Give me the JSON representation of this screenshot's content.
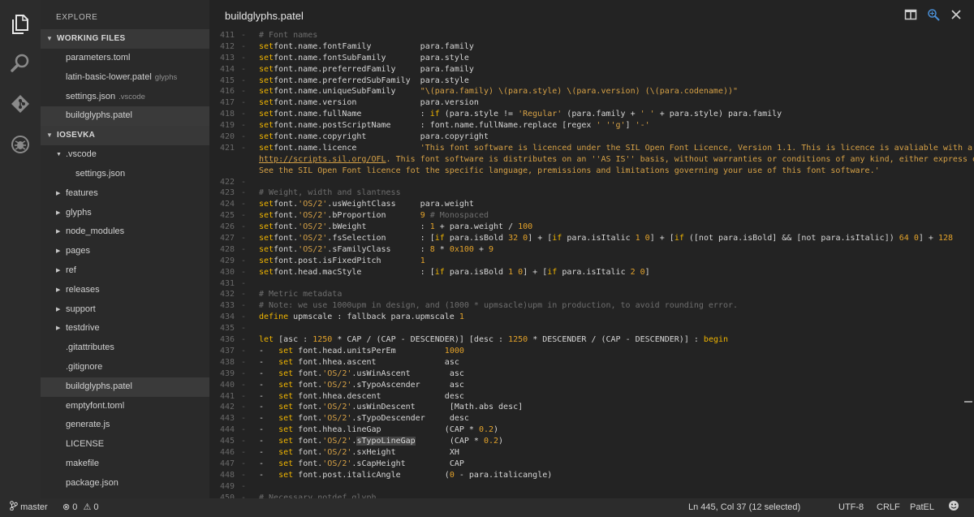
{
  "activity_bar": {
    "items": [
      {
        "icon": "files-icon",
        "active": true
      },
      {
        "icon": "search-icon",
        "active": false
      },
      {
        "icon": "git-icon",
        "active": false
      },
      {
        "icon": "debug-icon",
        "active": false
      }
    ]
  },
  "sidebar": {
    "title": "EXPLORE",
    "working_files_header": "WORKING FILES",
    "working_files": [
      {
        "name": "parameters.toml",
        "hint": ""
      },
      {
        "name": "latin-basic-lower.patel",
        "hint": "glyphs"
      },
      {
        "name": "settings.json",
        "hint": ".vscode"
      },
      {
        "name": "buildglyphs.patel",
        "hint": "",
        "active": true
      }
    ],
    "project_header": "IOSEVKA",
    "tree": [
      {
        "name": ".vscode",
        "type": "folder-open",
        "indent": 0
      },
      {
        "name": "settings.json",
        "type": "file",
        "indent": 1
      },
      {
        "name": "features",
        "type": "folder",
        "indent": 0
      },
      {
        "name": "glyphs",
        "type": "folder",
        "indent": 0
      },
      {
        "name": "node_modules",
        "type": "folder",
        "indent": 0
      },
      {
        "name": "pages",
        "type": "folder",
        "indent": 0
      },
      {
        "name": "ref",
        "type": "folder",
        "indent": 0
      },
      {
        "name": "releases",
        "type": "folder",
        "indent": 0
      },
      {
        "name": "support",
        "type": "folder",
        "indent": 0
      },
      {
        "name": "testdrive",
        "type": "folder",
        "indent": 0
      },
      {
        "name": ".gitattributes",
        "type": "file",
        "indent": 0
      },
      {
        "name": ".gitignore",
        "type": "file",
        "indent": 0
      },
      {
        "name": "buildglyphs.patel",
        "type": "file",
        "indent": 0,
        "active": true
      },
      {
        "name": "emptyfont.toml",
        "type": "file",
        "indent": 0
      },
      {
        "name": "generate.js",
        "type": "file",
        "indent": 0
      },
      {
        "name": "LICENSE",
        "type": "file",
        "indent": 0
      },
      {
        "name": "makefile",
        "type": "file",
        "indent": 0
      },
      {
        "name": "package.json",
        "type": "file",
        "indent": 0
      }
    ]
  },
  "editor": {
    "title": "buildglyphs.patel",
    "split_icon": "split-editor-icon",
    "diff_icon": "open-changes-icon",
    "lines": [
      {
        "n": "411",
        "fold": "-",
        "segs": [
          [
            "c",
            "# Font names"
          ]
        ]
      },
      {
        "n": "412",
        "fold": "-",
        "segs": [
          [
            "k",
            "set"
          ],
          [
            "",
            "font.name.fontFamily          para.family"
          ]
        ]
      },
      {
        "n": "413",
        "fold": "-",
        "segs": [
          [
            "k",
            "set"
          ],
          [
            "",
            "font.name.fontSubFamily       para.style"
          ]
        ]
      },
      {
        "n": "414",
        "fold": "-",
        "segs": [
          [
            "k",
            "set"
          ],
          [
            "",
            "font.name.preferredFamily     para.family"
          ]
        ]
      },
      {
        "n": "415",
        "fold": "-",
        "segs": [
          [
            "k",
            "set"
          ],
          [
            "",
            "font.name.preferredSubFamily  para.style"
          ]
        ]
      },
      {
        "n": "416",
        "fold": "-",
        "segs": [
          [
            "k",
            "set"
          ],
          [
            "",
            "font.name.uniqueSubFamily     "
          ],
          [
            "s",
            "\"\\(para.family) \\(para.style) \\(para.version) (\\(para.codename))\""
          ]
        ]
      },
      {
        "n": "417",
        "fold": "-",
        "segs": [
          [
            "k",
            "set"
          ],
          [
            "",
            "font.name.version             para.version"
          ]
        ]
      },
      {
        "n": "418",
        "fold": "-",
        "segs": [
          [
            "k",
            "set"
          ],
          [
            "",
            "font.name.fullName            : "
          ],
          [
            "k",
            "if"
          ],
          [
            "",
            " (para.style != "
          ],
          [
            "s",
            "'Regular'"
          ],
          [
            "",
            " (para.family + "
          ],
          [
            "s",
            "' '"
          ],
          [
            "",
            " + para.style) para.family"
          ]
        ]
      },
      {
        "n": "419",
        "fold": "-",
        "segs": [
          [
            "k",
            "set"
          ],
          [
            "",
            "font.name.postScriptName      : font.name.fullName.replace [regex "
          ],
          [
            "s",
            "' '"
          ],
          [
            " ",
            ""
          ],
          [
            "s",
            "'g'"
          ],
          [
            "",
            "] "
          ],
          [
            "s",
            "'-'"
          ]
        ]
      },
      {
        "n": "420",
        "fold": "-",
        "segs": [
          [
            "k",
            "set"
          ],
          [
            "",
            "font.name.copyright           para.copyright"
          ]
        ]
      },
      {
        "n": "421",
        "fold": "-",
        "segs": [
          [
            "k",
            "set"
          ],
          [
            "",
            "font.name.licence             "
          ],
          [
            "s",
            "'This font software is licenced under the SIL Open Font Licence, Version 1.1. This is licence is avaliable with a FAQ at:¬"
          ]
        ]
      },
      {
        "n": "",
        "fold": "",
        "segs": [
          [
            "u",
            "http://scripts.sil.org/OFL"
          ],
          [
            "s",
            ". This font software is distributes on an ''AS IS'' basis, without warranties or conditions of any kind, either express or implied.¬"
          ]
        ]
      },
      {
        "n": "",
        "fold": "",
        "segs": [
          [
            "s",
            "See the SIL Open Font licence fot the specific language, premissions and limitations governing your use of this font software.'"
          ]
        ]
      },
      {
        "n": "422",
        "fold": "-",
        "segs": []
      },
      {
        "n": "423",
        "fold": "-",
        "segs": [
          [
            "c",
            "# Weight, width and slantness"
          ]
        ]
      },
      {
        "n": "424",
        "fold": "-",
        "segs": [
          [
            "k",
            "set"
          ],
          [
            "",
            "font."
          ],
          [
            "s",
            "'OS/2'"
          ],
          [
            "",
            ".usWeightClass     para.weight"
          ]
        ]
      },
      {
        "n": "425",
        "fold": "-",
        "segs": [
          [
            "k",
            "set"
          ],
          [
            "",
            "font."
          ],
          [
            "s",
            "'OS/2'"
          ],
          [
            "",
            ".bProportion       "
          ],
          [
            "n",
            "9"
          ],
          [
            "c",
            " # Monospaced"
          ]
        ]
      },
      {
        "n": "426",
        "fold": "-",
        "segs": [
          [
            "k",
            "set"
          ],
          [
            "",
            "font."
          ],
          [
            "s",
            "'OS/2'"
          ],
          [
            "",
            ".bWeight           : "
          ],
          [
            "n",
            "1"
          ],
          [
            "",
            " + para.weight / "
          ],
          [
            "n",
            "100"
          ]
        ]
      },
      {
        "n": "427",
        "fold": "-",
        "segs": [
          [
            "k",
            "set"
          ],
          [
            "",
            "font."
          ],
          [
            "s",
            "'OS/2'"
          ],
          [
            "",
            ".fsSelection       : ["
          ],
          [
            "k",
            "if"
          ],
          [
            "",
            " para.isBold "
          ],
          [
            "n",
            "32 0"
          ],
          [
            "",
            "] + ["
          ],
          [
            "k",
            "if"
          ],
          [
            "",
            " para.isItalic "
          ],
          [
            "n",
            "1 0"
          ],
          [
            "",
            "] + ["
          ],
          [
            "k",
            "if"
          ],
          [
            "",
            " ([not para.isBold] && [not para.isItalic]) "
          ],
          [
            "n",
            "64 0"
          ],
          [
            "",
            "] + "
          ],
          [
            "n",
            "128"
          ]
        ]
      },
      {
        "n": "428",
        "fold": "-",
        "segs": [
          [
            "k",
            "set"
          ],
          [
            "",
            "font."
          ],
          [
            "s",
            "'OS/2'"
          ],
          [
            "",
            ".sFamilyClass      : "
          ],
          [
            "n",
            "8"
          ],
          [
            "",
            " * "
          ],
          [
            "n",
            "0x100"
          ],
          [
            "",
            " + "
          ],
          [
            "n",
            "9"
          ]
        ]
      },
      {
        "n": "429",
        "fold": "-",
        "segs": [
          [
            "k",
            "set"
          ],
          [
            "",
            "font.post.isFixedPitch        "
          ],
          [
            "n",
            "1"
          ]
        ]
      },
      {
        "n": "430",
        "fold": "-",
        "segs": [
          [
            "k",
            "set"
          ],
          [
            "",
            "font.head.macStyle            : ["
          ],
          [
            "k",
            "if"
          ],
          [
            "",
            " para.isBold "
          ],
          [
            "n",
            "1 0"
          ],
          [
            "",
            "] + ["
          ],
          [
            "k",
            "if"
          ],
          [
            "",
            " para.isItalic "
          ],
          [
            "n",
            "2 0"
          ],
          [
            "",
            "]"
          ]
        ]
      },
      {
        "n": "431",
        "fold": "-",
        "segs": []
      },
      {
        "n": "432",
        "fold": "-",
        "segs": [
          [
            "c",
            "# Metric metadata"
          ]
        ]
      },
      {
        "n": "433",
        "fold": "-",
        "segs": [
          [
            "c",
            "# Note: we use 1000upm in design, and (1000 * upmsacle)upm in production, to avoid rounding error."
          ]
        ]
      },
      {
        "n": "434",
        "fold": "-",
        "segs": [
          [
            "k",
            "define"
          ],
          [
            "",
            " upmscale : fallback para.upmscale "
          ],
          [
            "n",
            "1"
          ]
        ]
      },
      {
        "n": "435",
        "fold": "-",
        "segs": []
      },
      {
        "n": "436",
        "fold": "-",
        "segs": [
          [
            "k",
            "let"
          ],
          [
            "",
            " [asc : "
          ],
          [
            "n",
            "1250"
          ],
          [
            "",
            " * CAP / (CAP - DESCENDER)] [desc : "
          ],
          [
            "n",
            "1250"
          ],
          [
            "",
            " * DESCENDER / (CAP - DESCENDER)] : "
          ],
          [
            "k",
            "begin"
          ]
        ]
      },
      {
        "n": "437",
        "fold": "-",
        "segs": [
          [
            "",
            "-   "
          ],
          [
            "k",
            "set"
          ],
          [
            "",
            " font.head.unitsPerEm          "
          ],
          [
            "n",
            "1000"
          ]
        ]
      },
      {
        "n": "438",
        "fold": "-",
        "segs": [
          [
            "",
            "-   "
          ],
          [
            "k",
            "set"
          ],
          [
            "",
            " font.hhea.ascent              asc"
          ]
        ]
      },
      {
        "n": "439",
        "fold": "-",
        "segs": [
          [
            "",
            "-   "
          ],
          [
            "k",
            "set"
          ],
          [
            "",
            " font."
          ],
          [
            "s",
            "'OS/2'"
          ],
          [
            "",
            ".usWinAscent        asc"
          ]
        ]
      },
      {
        "n": "440",
        "fold": "-",
        "segs": [
          [
            "",
            "-   "
          ],
          [
            "k",
            "set"
          ],
          [
            "",
            " font."
          ],
          [
            "s",
            "'OS/2'"
          ],
          [
            "",
            ".sTypoAscender      asc"
          ]
        ]
      },
      {
        "n": "441",
        "fold": "-",
        "segs": [
          [
            "",
            "-   "
          ],
          [
            "k",
            "set"
          ],
          [
            "",
            " font.hhea.descent             desc"
          ]
        ]
      },
      {
        "n": "442",
        "fold": "-",
        "segs": [
          [
            "",
            "-   "
          ],
          [
            "k",
            "set"
          ],
          [
            "",
            " font."
          ],
          [
            "s",
            "'OS/2'"
          ],
          [
            "",
            ".usWinDescent       [Math.abs desc]"
          ]
        ]
      },
      {
        "n": "443",
        "fold": "-",
        "segs": [
          [
            "",
            "-   "
          ],
          [
            "k",
            "set"
          ],
          [
            "",
            " font."
          ],
          [
            "s",
            "'OS/2'"
          ],
          [
            "",
            ".sTypoDescender     desc"
          ]
        ]
      },
      {
        "n": "444",
        "fold": "-",
        "segs": [
          [
            "",
            "-   "
          ],
          [
            "k",
            "set"
          ],
          [
            "",
            " font.hhea.lineGap             (CAP * "
          ],
          [
            "n",
            "0.2"
          ],
          [
            "",
            ")"
          ]
        ]
      },
      {
        "n": "445",
        "fold": "-",
        "segs": [
          [
            "",
            "-   "
          ],
          [
            "k",
            "set"
          ],
          [
            "",
            " font."
          ],
          [
            "s",
            "'OS/2'"
          ],
          [
            "",
            "."
          ],
          [
            "sel",
            "sTypoLineGap"
          ],
          [
            "",
            "       (CAP * "
          ],
          [
            "n",
            "0.2"
          ],
          [
            "",
            ")"
          ]
        ]
      },
      {
        "n": "446",
        "fold": "-",
        "segs": [
          [
            "",
            "-   "
          ],
          [
            "k",
            "set"
          ],
          [
            "",
            " font."
          ],
          [
            "s",
            "'OS/2'"
          ],
          [
            "",
            ".sxHeight           XH"
          ]
        ]
      },
      {
        "n": "447",
        "fold": "-",
        "segs": [
          [
            "",
            "-   "
          ],
          [
            "k",
            "set"
          ],
          [
            "",
            " font."
          ],
          [
            "s",
            "'OS/2'"
          ],
          [
            "",
            ".sCapHeight         CAP"
          ]
        ]
      },
      {
        "n": "448",
        "fold": "-",
        "segs": [
          [
            "",
            "-   "
          ],
          [
            "k",
            "set"
          ],
          [
            "",
            " font.post.italicAngle         ("
          ],
          [
            "n",
            "0"
          ],
          [
            "",
            " - para.italicangle)"
          ]
        ]
      },
      {
        "n": "449",
        "fold": "-",
        "segs": []
      },
      {
        "n": "450",
        "fold": "-",
        "segs": [
          [
            "c",
            "# Necessary notdef glyph"
          ]
        ]
      }
    ]
  },
  "status": {
    "branch": "master",
    "errors": "0",
    "warnings": "0",
    "position": "Ln 445, Col 37 (12 selected)",
    "encoding": "UTF-8",
    "eol": "CRLF",
    "language": "PatEL",
    "feedback_icon": "smiley-icon"
  }
}
